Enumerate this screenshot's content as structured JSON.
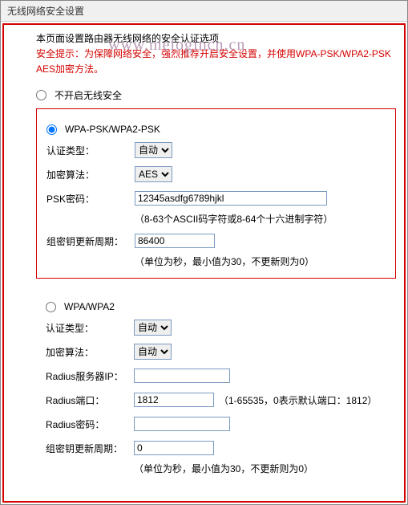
{
  "window": {
    "title": "无线网络安全设置"
  },
  "watermark": "www.melogincn.cn",
  "intro": "本页面设置路由器无线网络的安全认证选项",
  "warning": "安全提示：为保障网络安全，强烈推荐开启安全设置，并使用WPA-PSK/WPA2-PSK AES加密方法。",
  "radios": {
    "none": "不开启无线安全",
    "wpapsk": "WPA-PSK/WPA2-PSK",
    "wpa": "WPA/WPA2"
  },
  "wpapsk": {
    "auth_label": "认证类型：",
    "auth_value": "自动",
    "enc_label": "加密算法：",
    "enc_value": "AES",
    "psk_label": "PSK密码：",
    "psk_value": "12345asdfg6789hjkl",
    "psk_hint": "（8-63个ASCII码字符或8-64个十六进制字符）",
    "gk_label": "组密钥更新周期：",
    "gk_value": "86400",
    "gk_hint": "（单位为秒，最小值为30，不更新则为0）"
  },
  "wpa": {
    "auth_label": "认证类型：",
    "auth_value": "自动",
    "enc_label": "加密算法：",
    "enc_value": "自动",
    "radius_ip_label": "Radius服务器IP：",
    "radius_ip_value": "",
    "radius_port_label": "Radius端口：",
    "radius_port_value": "1812",
    "radius_port_hint": "（1-65535，0表示默认端口：1812）",
    "radius_pw_label": "Radius密码：",
    "radius_pw_value": "",
    "gk_label": "组密钥更新周期：",
    "gk_value": "0",
    "gk_hint": "（单位为秒，最小值为30，不更新则为0）"
  }
}
